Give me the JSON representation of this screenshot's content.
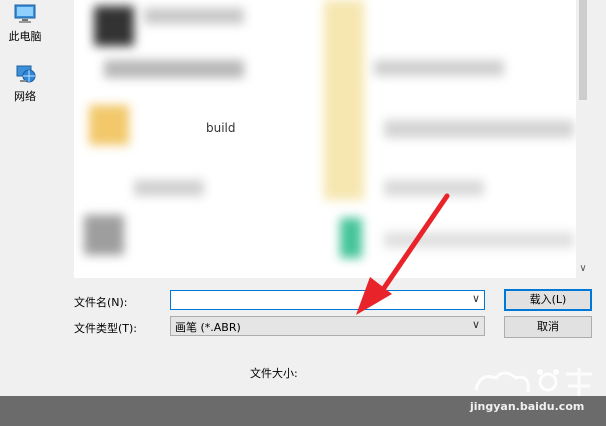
{
  "nav": {
    "items": [
      {
        "label": "此电脑",
        "icon": "computer-icon"
      },
      {
        "label": "网络",
        "icon": "network-icon"
      }
    ]
  },
  "file_list": {
    "visible_item_name": "build"
  },
  "filename": {
    "label": "文件名(N):",
    "value": ""
  },
  "filetype": {
    "label": "文件类型(T):",
    "value": "画笔 (*.ABR)"
  },
  "buttons": {
    "load": "载入(L)",
    "cancel": "取消"
  },
  "file_size_label": "文件大小:",
  "watermark": {
    "text": "jingyan.baidu.com"
  },
  "colors": {
    "accent": "#0078d7",
    "annotation": "#e8232a",
    "background": "#f0f0f0"
  }
}
